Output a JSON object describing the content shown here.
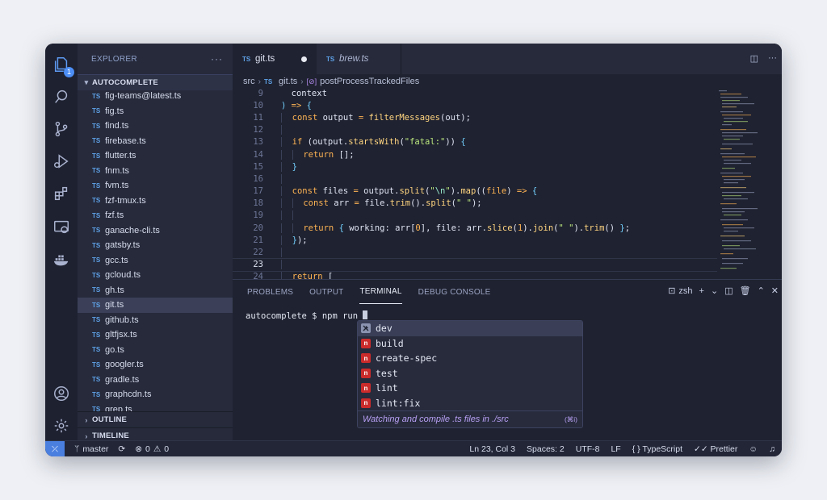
{
  "sidebar": {
    "title": "EXPLORER",
    "more": "···",
    "folder": "AUTOCOMPLETE",
    "files": [
      "fig-teams@latest.ts",
      "fig.ts",
      "find.ts",
      "firebase.ts",
      "flutter.ts",
      "fnm.ts",
      "fvm.ts",
      "fzf-tmux.ts",
      "fzf.ts",
      "ganache-cli.ts",
      "gatsby.ts",
      "gcc.ts",
      "gcloud.ts",
      "gh.ts",
      "git.ts",
      "github.ts",
      "gltfjsx.ts",
      "go.ts",
      "googler.ts",
      "gradle.ts",
      "graphcdn.ts",
      "grep.ts"
    ],
    "file_tag": "TS",
    "active_file": "git.ts",
    "outline": "OUTLINE",
    "timeline": "TIMELINE",
    "explorer_badge": "1"
  },
  "tabs": [
    {
      "tag": "TS",
      "label": "git.ts"
    },
    {
      "tag": "TS",
      "label": "brew.ts"
    }
  ],
  "breadcrumb": {
    "folder": "src",
    "file": "git.ts",
    "symbol": "postProcessTrackedFiles"
  },
  "code": {
    "line_numbers": [
      "9",
      "10",
      "11",
      "12",
      "13",
      "14",
      "15",
      "16",
      "17",
      "18",
      "19",
      "20",
      "21",
      "22",
      "23",
      "24"
    ],
    "current_line": "23"
  },
  "panel": {
    "tabs": [
      "PROBLEMS",
      "OUTPUT",
      "TERMINAL",
      "DEBUG CONSOLE"
    ],
    "active_tab": "TERMINAL",
    "shell": "zsh",
    "prompt": "autocomplete $ npm run "
  },
  "suggestions": {
    "items": [
      "dev",
      "build",
      "create-spec",
      "test",
      "lint",
      "lint:fix"
    ],
    "selected": "dev",
    "description": "Watching and compile .ts files in ./src",
    "shortcut": "(⌘i)"
  },
  "status": {
    "branch": "master",
    "errors": "0",
    "warnings": "0",
    "cursor": "Ln 23, Col 3",
    "spaces": "Spaces: 2",
    "encoding": "UTF-8",
    "eol": "LF",
    "language": "TypeScript",
    "formatter": "Prettier"
  },
  "colors": {
    "accent": "#4a7fe0",
    "editor_bg": "#1f2230",
    "sidebar_bg": "#262a3b",
    "npm_red": "#cb2b2b",
    "description_purple": "#b9a0f5"
  },
  "icons": {
    "activity_bar": [
      "files-icon",
      "search-icon",
      "source-control-icon",
      "run-debug-icon",
      "extensions-icon",
      "remote-explorer-icon",
      "docker-icon",
      "account-icon",
      "settings-gear-icon"
    ]
  }
}
